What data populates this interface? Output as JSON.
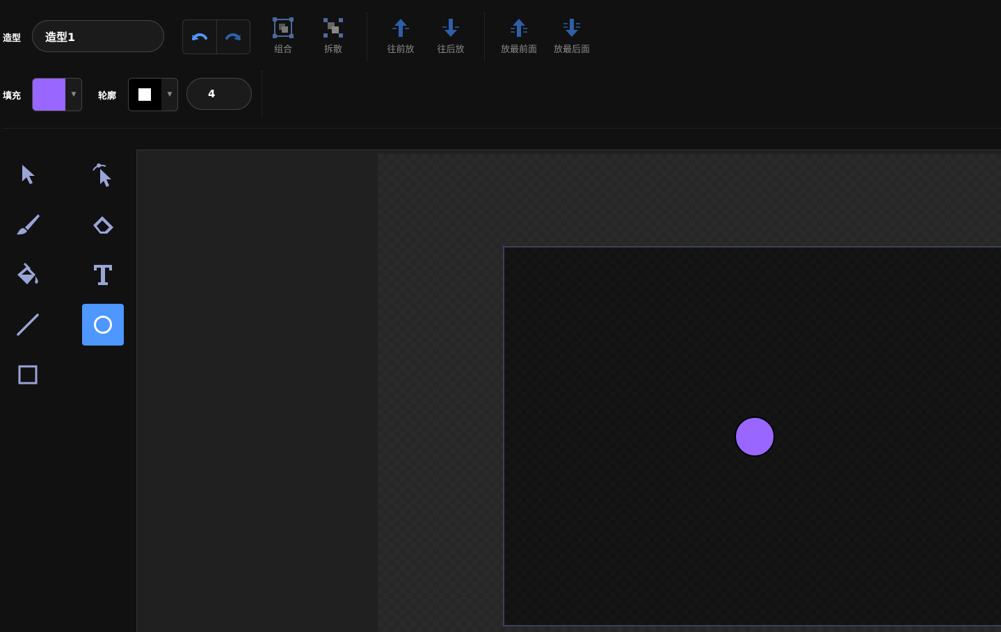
{
  "costume": {
    "label": "造型",
    "name_value": "造型1"
  },
  "history": {
    "undo_icon": "undo-icon",
    "redo_icon": "redo-icon"
  },
  "arrange": {
    "group": "组合",
    "ungroup": "拆散",
    "forward": "往前放",
    "backward": "往后放",
    "front": "放最前面",
    "back": "放最后面"
  },
  "fill": {
    "label": "填充",
    "color": "#9966ff"
  },
  "outline": {
    "label": "轮廓",
    "color": "#000000",
    "inner_color": "#ffffff",
    "width_value": "4"
  },
  "tools": [
    {
      "name": "select-icon",
      "active": false
    },
    {
      "name": "reshape-icon",
      "active": false
    },
    {
      "name": "brush-icon",
      "active": false
    },
    {
      "name": "eraser-icon",
      "active": false
    },
    {
      "name": "fill-bucket-icon",
      "active": false
    },
    {
      "name": "text-icon",
      "active": false
    },
    {
      "name": "line-icon",
      "active": false
    },
    {
      "name": "circle-icon",
      "active": true
    },
    {
      "name": "rectangle-icon",
      "active": false
    }
  ],
  "canvas": {
    "shape": "circle",
    "shape_fill": "#9966ff",
    "shape_outline": "#000000"
  },
  "colors": {
    "accent": "#4d97ff",
    "arrow_blue": "#2f5fa8"
  }
}
